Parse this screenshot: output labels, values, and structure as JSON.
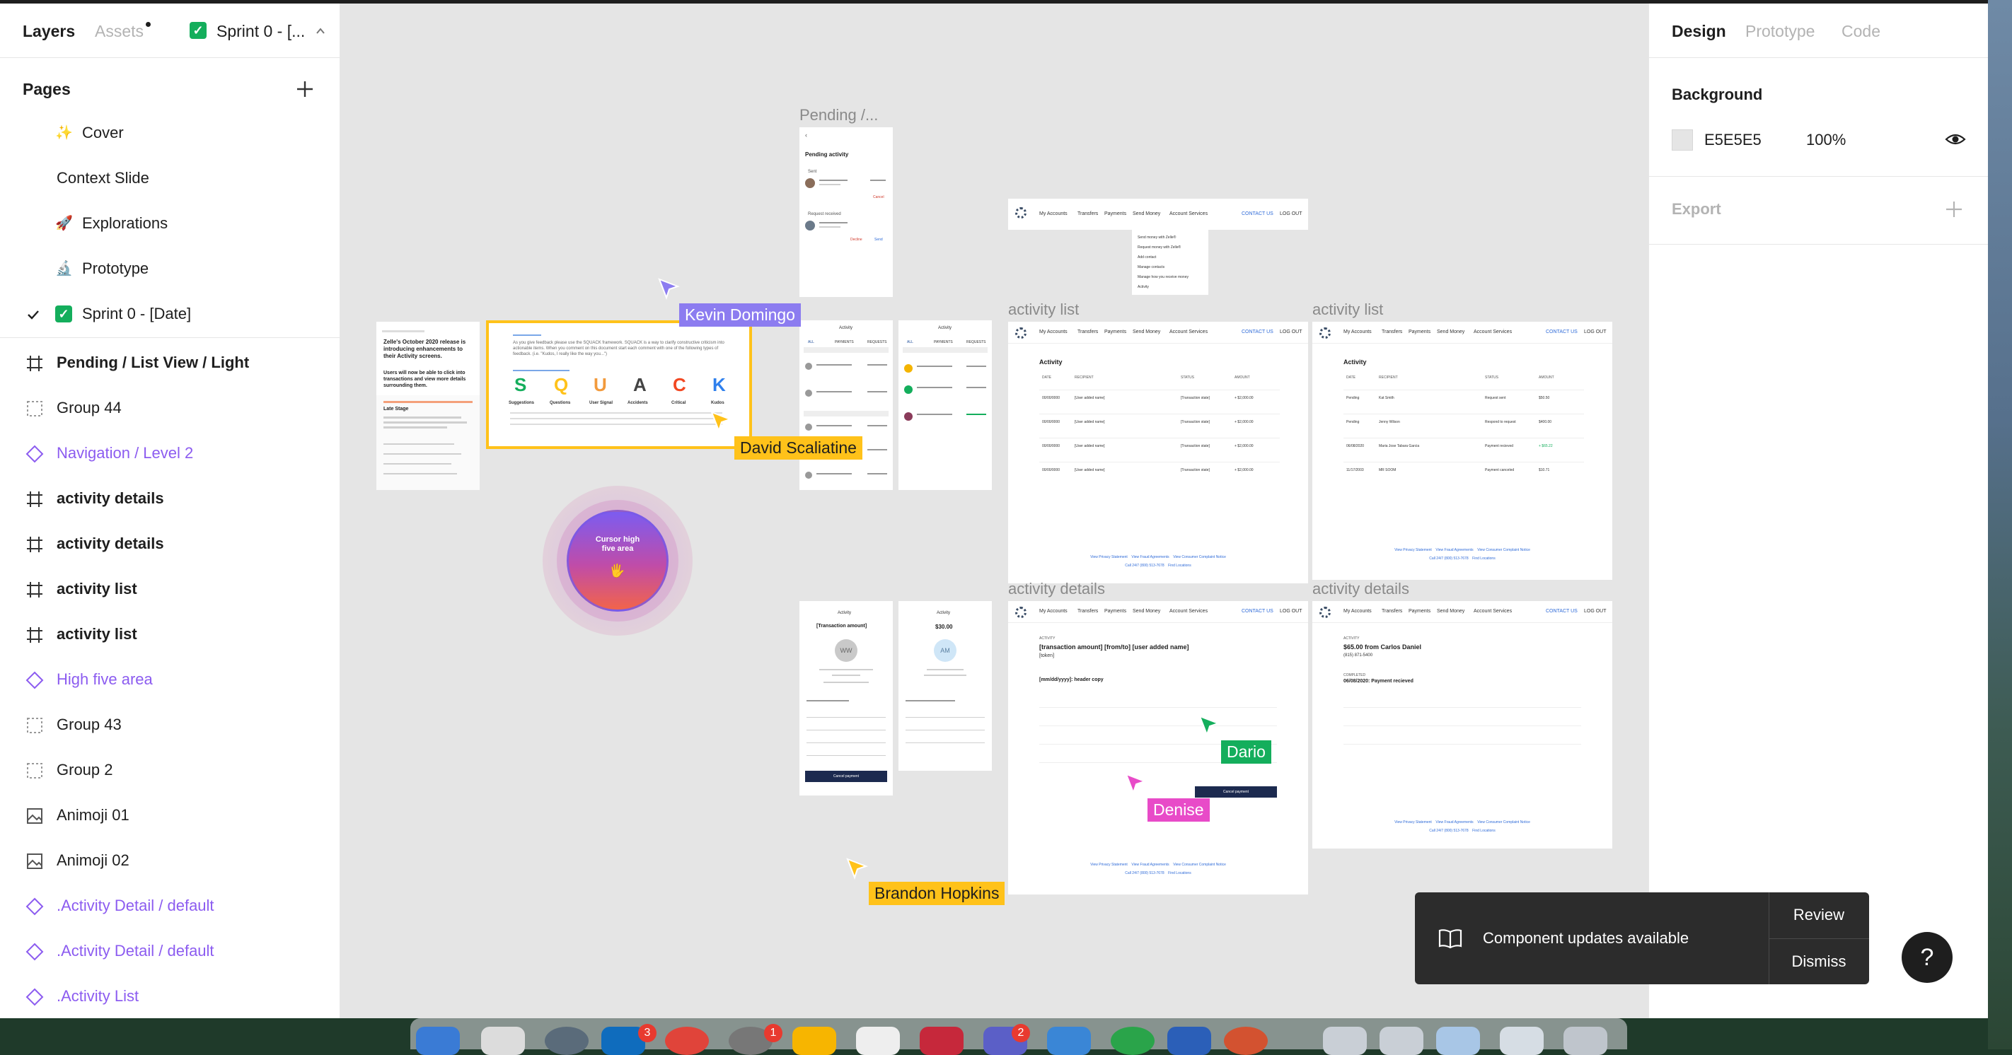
{
  "left_panel": {
    "tabs": {
      "layers": "Layers",
      "assets": "Assets",
      "file_title": "Sprint 0 - [..."
    },
    "pages_title": "Pages",
    "pages": [
      {
        "label": "Cover",
        "emoji": "✨"
      },
      {
        "label": "Context Slide",
        "emoji": ""
      },
      {
        "label": "Explorations",
        "emoji": "🚀"
      },
      {
        "label": "Prototype",
        "emoji": "🔬"
      },
      {
        "label": "Sprint 0 - [Date]",
        "emoji": "✅",
        "current": true
      }
    ],
    "layers": [
      {
        "label": "Pending / List View / Light",
        "type": "frame",
        "bold": true
      },
      {
        "label": "Group 44",
        "type": "group"
      },
      {
        "label": "Navigation / Level 2",
        "type": "component"
      },
      {
        "label": "activity details",
        "type": "frame",
        "bold": true
      },
      {
        "label": "activity details",
        "type": "frame",
        "bold": true
      },
      {
        "label": "activity list",
        "type": "frame",
        "bold": true
      },
      {
        "label": "activity list",
        "type": "frame",
        "bold": true
      },
      {
        "label": "High five area",
        "type": "component"
      },
      {
        "label": "Group 43",
        "type": "group"
      },
      {
        "label": "Group 2",
        "type": "group"
      },
      {
        "label": "Animoji 01",
        "type": "image"
      },
      {
        "label": "Animoji 02",
        "type": "image"
      },
      {
        "label": ".Activity Detail / default",
        "type": "component"
      },
      {
        "label": ".Activity Detail / default",
        "type": "component"
      },
      {
        "label": ".Activity List",
        "type": "component"
      }
    ]
  },
  "right_panel": {
    "tabs": {
      "design": "Design",
      "prototype": "Prototype",
      "code": "Code"
    },
    "background_title": "Background",
    "background_hex": "E5E5E5",
    "background_opacity": "100%",
    "export_title": "Export"
  },
  "canvas": {
    "frame_labels": {
      "pending": "Pending /...",
      "activity_list_1": "activity list",
      "activity_list_2": "activity list",
      "activity_details_1": "activity details",
      "activity_details_2": "activity details"
    },
    "squack": {
      "intro": "As you give feedback please use the SQUACK framework. SQUACK is a way to clarify constructive criticism into actionable items. When you comment on this document start each comment with one of the following types of feedback. (i.e. \"Kudos, I really like the way you...\")",
      "letters": [
        "S",
        "Q",
        "U",
        "A",
        "C",
        "K"
      ],
      "words": [
        "Suggestions",
        "Questions",
        "User Signal",
        "Accidents",
        "Critical",
        "Kudos"
      ]
    },
    "context_card": {
      "headline": "Zelle's October 2020 release is introducing enhancements to their Activity screens.",
      "sub": "Users will now be able to click into transactions and view more details surrounding them.",
      "stage_title": "Late Stage"
    },
    "high_five": {
      "title": "Cursor high five area",
      "emoji": "🖐"
    },
    "pending_mobile": {
      "title": "Pending activity",
      "sent": "Sent",
      "requests": "Request received",
      "cancel": "Cancel",
      "decline": "Decline",
      "send": "Send"
    },
    "activity_mobile": {
      "title": "Activity",
      "tabs": [
        "ALL",
        "PAYMENTS",
        "REQUESTS"
      ]
    },
    "detail_mobile_1": {
      "title": "Activity",
      "amount": "[Transaction amount]",
      "initials": "WW",
      "button": "Cancel payment"
    },
    "detail_mobile_2": {
      "title": "Activity",
      "amount": "$30.00",
      "initials": "AM"
    },
    "desktop_nav": {
      "items": [
        "My Accounts",
        "Transfers",
        "Payments",
        "Send Money",
        "Account Services"
      ],
      "contact": "CONTACT US",
      "logout": "LOG OUT"
    },
    "nav_dropdown": [
      "Send money with Zelle®",
      "Request money with Zelle®",
      "Add contact",
      "Manage contacts",
      "Manage how you receive money",
      "Activity"
    ],
    "activity_list_1": {
      "title": "Activity",
      "headers": [
        "DATE",
        "RECIPIENT",
        "STATUS",
        "AMOUNT"
      ],
      "rows": [
        [
          "00/00/0000",
          "[User added name]",
          "[Transaction state]",
          "+ $2,000.00"
        ],
        [
          "00/00/0000",
          "[User added name]",
          "[Transaction state]",
          "+ $2,000.00"
        ],
        [
          "00/00/0000",
          "[User added name]",
          "[Transaction state]",
          "+ $2,000.00"
        ],
        [
          "00/00/0000",
          "[User added name]",
          "[Transaction state]",
          "+ $2,000.00"
        ]
      ]
    },
    "activity_list_2": {
      "title": "Activity",
      "headers": [
        "DATE",
        "RECIPIENT",
        "STATUS",
        "AMOUNT"
      ],
      "rows": [
        [
          "Pending",
          "Kat Smith",
          "Request sent",
          "$50.50"
        ],
        [
          "Pending",
          "Jenny Wilson",
          "Respond to request",
          "$400.00"
        ],
        [
          "06/08/2020",
          "Maria Jose Tabara Garcia",
          "Payment recieved",
          "+ $65.22"
        ],
        [
          "11/17/2003",
          "MR SOOM",
          "Payment canceled",
          "$10.71"
        ]
      ]
    },
    "footer": {
      "links": "View Privacy Statement    View Fraud Agreements    View Consumer Complaint Notice",
      "call": "Call 24/7 (800) 513-7678    Find Locations"
    },
    "details_1": {
      "label": "ACTIVITY",
      "headline": "[transaction amount] [from/to] [user added name]",
      "token": "[token]",
      "date": "[mm/dd/yyyy]: header copy",
      "button": "Cancel payment"
    },
    "details_2": {
      "label": "ACTIVITY",
      "headline": "$65.00 from Carlos Daniel",
      "phone": "(815) 871-5400",
      "completed_label": "COMPLETED",
      "completed": "06/08/2020: Payment recieved"
    }
  },
  "cursors": [
    {
      "name": "Kevin Domingo",
      "color": "#8c7cf0"
    },
    {
      "name": "David Scaliatine",
      "color": "#ffc21a"
    },
    {
      "name": "Dario",
      "color": "#14ae5c"
    },
    {
      "name": "Denise",
      "color": "#e84bc8"
    },
    {
      "name": "Brandon Hopkins",
      "color": "#ffc21a"
    }
  ],
  "toast": {
    "message": "Component updates available",
    "review": "Review",
    "dismiss": "Dismiss"
  },
  "help": "?",
  "dock_badges": [
    "3",
    "1",
    "2"
  ]
}
